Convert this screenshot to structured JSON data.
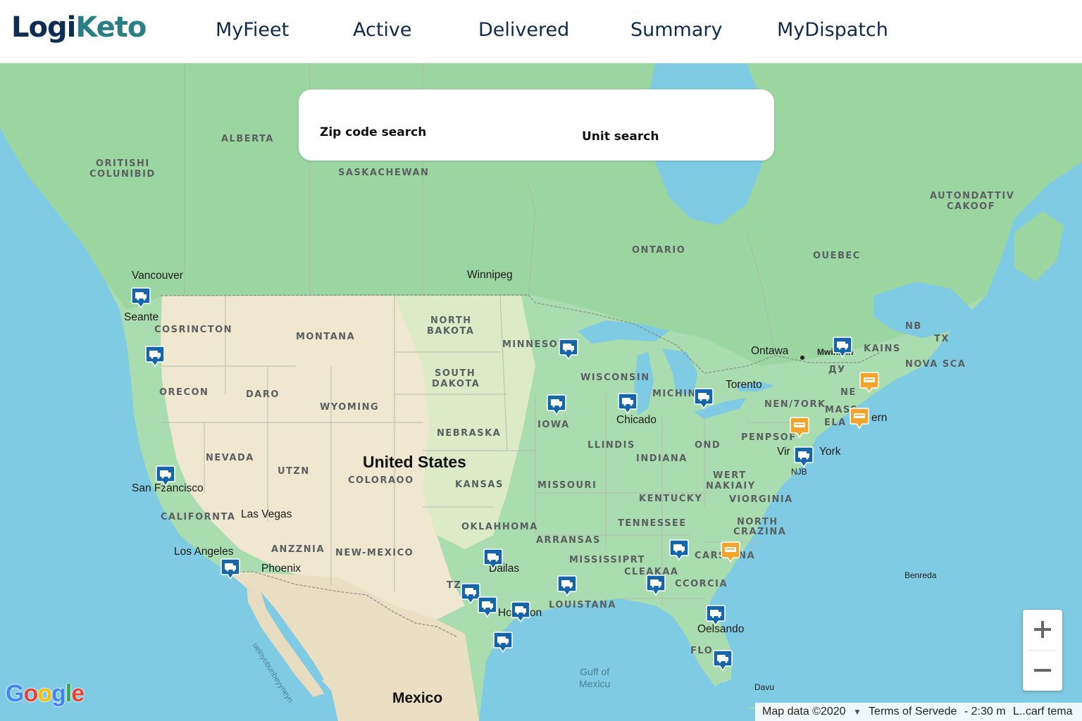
{
  "app": {
    "logo_part1": "Logi",
    "logo_part2": "Keto"
  },
  "nav": [
    {
      "label": "MyFieet"
    },
    {
      "label": "Active"
    },
    {
      "label": "Delivered"
    },
    {
      "label": "Summary"
    },
    {
      "label": "MyDispatch"
    }
  ],
  "search": {
    "zip_label": "Zip code search",
    "unit_label": "Unit  search"
  },
  "map": {
    "region_labels": {
      "alberta": "ALBERTA",
      "british_columbia_1": "ORITISHI",
      "british_columbia_2": "COLUNIBID",
      "saskatchewan": "SASKACHEWAN",
      "ontario": "ONTARIO",
      "quebec": "OUEBEC",
      "autonomous_1": "AUTONDATTIV",
      "autonomous_2": "CAKOOF",
      "north_dakota_1": "NORTH",
      "north_dakota_2": "BAKOTA",
      "south_dakota_1": "SOUTH",
      "south_dakota_2": "DAKOTA",
      "minnesota": "MINNESOT",
      "wisconsin": "WISCONSIN",
      "michigan": "MICHIN",
      "montana": "MONTANA",
      "washington": "COSRINCTON",
      "oregon": "ORECON",
      "idaho": "DARO",
      "wyoming": "WYOMING",
      "nebraska": "NEBRASKA",
      "iowa": "IOWA",
      "illinois": "LLINDIS",
      "indiana": "INDIANA",
      "ohio": "OND",
      "nevada": "NEVADA",
      "utah": "UTZN",
      "colorado": "COLORAOO",
      "kansas": "KANSAS",
      "missouri": "MISSOURI",
      "kentucky": "KENTUCKY",
      "west_virginia_1": "WERT",
      "west_virginia_2": "NAKIAIY",
      "virginia": "VIORGINIA",
      "california": "CALIFORNTA",
      "arizona": "ANZZNIA",
      "new_mexico": "NEW-MEXICO",
      "oklahoma": "OKLAHHOMA",
      "arkansas": "ARRANSAS",
      "tennessee": "TENNESSEE",
      "north_carolina_1": "NORTH",
      "north_carolina_2": "CRAZINA",
      "mississippi": "MISSISSIPRT",
      "alabama": "CLEAKAA",
      "georgia": "CCORCIA",
      "louisiana": "LOUISTANA",
      "south_carolina": "CARSZINA",
      "pennsylvania": "PENPSOF",
      "new_york": "NEN/7ORK",
      "mass_1": "MASS",
      "mass_2": "ELA",
      "nb": "NB",
      "ne": "NE",
      "nova_scotia": "NOVA SCA",
      "kains": "KAINS",
      "tx_small": "TX",
      "ny_small": "ДУ",
      "tz": "TZ",
      "flo": "FLO"
    },
    "city_labels": {
      "vancouver": "Vancouver",
      "seattle": "Seante",
      "winnipeg": "Winnipeg",
      "ottawa": "Ontawa",
      "montreal": "Mwinmin",
      "toronto": "Torento",
      "chicago": "Chicado",
      "boston_fragment": "ern",
      "new_york_1": "Vir",
      "new_york_2": "York",
      "new_york_3": "NJB",
      "san_francisco": "San Fzancisco",
      "las_vegas": "Las Vegas",
      "los_angeles": "Los Angeles",
      "phoenix": "Phoenix",
      "dallas": "Dailas",
      "houston_1": "Ho",
      "houston_2": "on",
      "orlando": "Oelsando",
      "bermuda": "Benreda",
      "davu": "Davu"
    },
    "country_labels": {
      "united_states": "United States",
      "mexico": "Mexico"
    },
    "water_labels": {
      "gulf": "Guff of\nMexicu",
      "gulf_california": "uelnyobunbeyyneyn"
    },
    "markers": [
      {
        "id": "seattle",
        "status": "active"
      },
      {
        "id": "portland",
        "status": "active"
      },
      {
        "id": "san-francisco",
        "status": "active"
      },
      {
        "id": "los-angeles",
        "status": "active"
      },
      {
        "id": "minneapolis",
        "status": "active"
      },
      {
        "id": "iowa",
        "status": "active"
      },
      {
        "id": "chicago",
        "status": "active"
      },
      {
        "id": "detroit",
        "status": "active"
      },
      {
        "id": "montreal",
        "status": "active"
      },
      {
        "id": "new-york",
        "status": "active"
      },
      {
        "id": "dallas",
        "status": "active"
      },
      {
        "id": "houston-1",
        "status": "active"
      },
      {
        "id": "houston-2",
        "status": "active"
      },
      {
        "id": "houston-3",
        "status": "active"
      },
      {
        "id": "corpus-christi",
        "status": "active"
      },
      {
        "id": "louisiana",
        "status": "active"
      },
      {
        "id": "atlanta",
        "status": "active"
      },
      {
        "id": "georgia",
        "status": "active"
      },
      {
        "id": "orlando",
        "status": "active"
      },
      {
        "id": "miami",
        "status": "active"
      },
      {
        "id": "maine",
        "status": "delayed"
      },
      {
        "id": "boston",
        "status": "delayed"
      },
      {
        "id": "pennsylvania",
        "status": "delayed"
      },
      {
        "id": "carolina",
        "status": "delayed"
      }
    ],
    "marker_colors": {
      "active": "#1565a8",
      "delayed": "#f2a52a"
    }
  },
  "zoom": {
    "in_icon": "plus-icon",
    "out_icon": "minus-icon"
  },
  "footer": {
    "logo": [
      "G",
      "o",
      "o",
      "g",
      "l",
      "e"
    ],
    "map_data": "Map data ©2020",
    "terms": "Terms of Servede",
    "scale": "- 2:30 m",
    "report": "L..carf tema"
  }
}
